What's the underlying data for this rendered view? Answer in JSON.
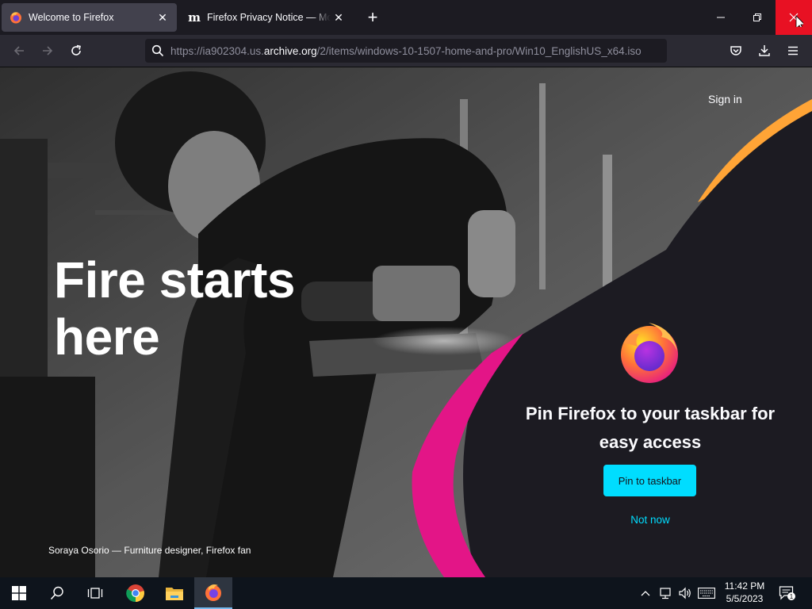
{
  "tabs": [
    {
      "title": "Welcome to Firefox",
      "active": true
    },
    {
      "title": "Firefox Privacy Notice — Mozilla",
      "active": false
    }
  ],
  "urlbar": {
    "scheme": "https://ia902304.us.",
    "host": "archive.org",
    "path": "/2/items/windows-10-1507-home-and-pro/Win10_EnglishUS_x64.iso"
  },
  "page": {
    "sign_in": "Sign in",
    "headline": "Fire starts here",
    "caption": "Soraya Osorio — Furniture designer, Firefox fan",
    "pin_title": "Pin Firefox to your taskbar for easy access",
    "pin_button": "Pin to taskbar",
    "not_now": "Not now"
  },
  "taskbar": {
    "time": "11:42 PM",
    "date": "5/5/2023",
    "notification_count": "1",
    "apps": [
      "start-icon",
      "search-icon",
      "task-view-icon",
      "chrome-icon",
      "file-explorer-icon",
      "firefox-icon"
    ]
  },
  "colors": {
    "accent_cyan": "#00ddff",
    "close_red": "#e81123",
    "magenta": "#e31587",
    "orange": "#ffa436",
    "panel_dark": "#1c1b22"
  }
}
